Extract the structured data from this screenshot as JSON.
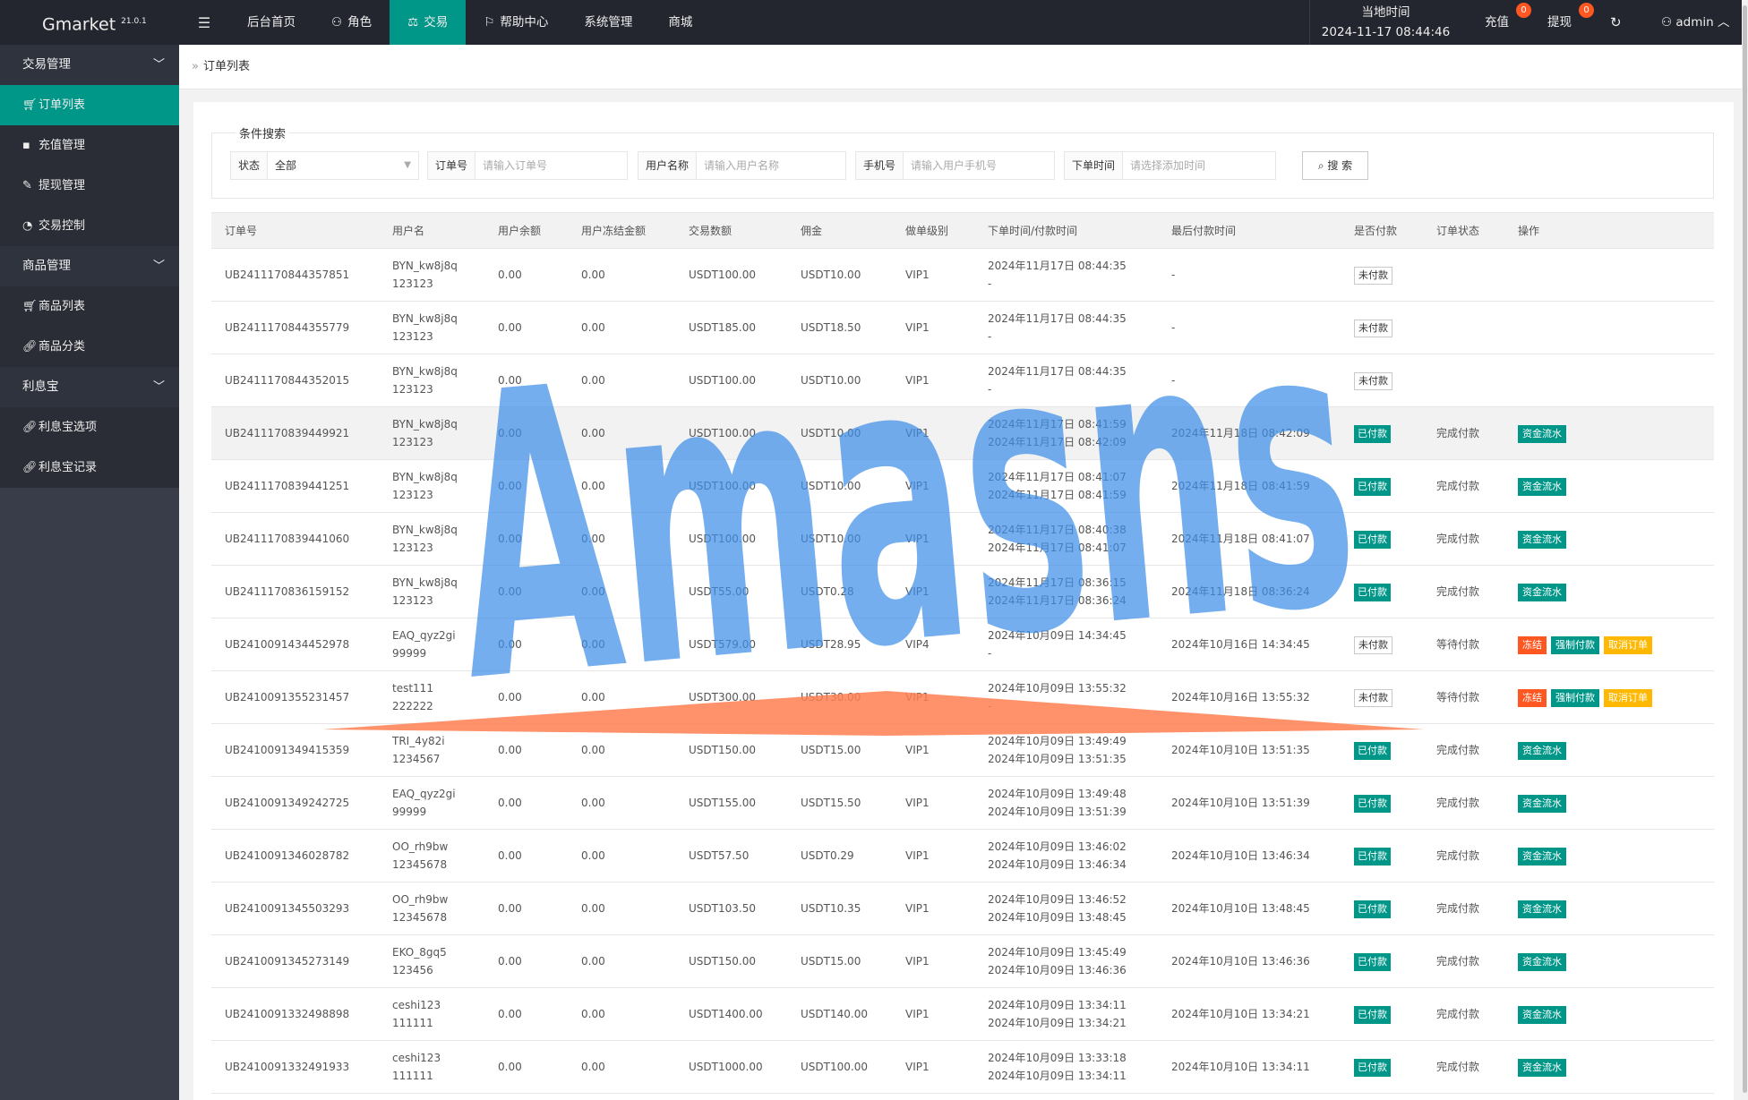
{
  "app": {
    "name": "Gmarket",
    "version": "21.0.1"
  },
  "nav": [
    {
      "label": "后台首页",
      "icon": ""
    },
    {
      "label": "角色",
      "icon": "user-icon"
    },
    {
      "label": "交易",
      "icon": "scale-icon",
      "active": true
    },
    {
      "label": "帮助中心",
      "icon": "flag-icon"
    },
    {
      "label": "系统管理",
      "icon": ""
    },
    {
      "label": "商城",
      "icon": ""
    }
  ],
  "header": {
    "clock_label": "当地时间",
    "clock_value": "2024-11-17 08:44:46",
    "recharge_label": "充值",
    "recharge_count": "0",
    "withdraw_label": "提现",
    "withdraw_count": "0",
    "user": "admin"
  },
  "sidebar": {
    "groups": [
      {
        "label": "交易管理",
        "items": [
          {
            "label": "订单列表",
            "icon": "cart-icon",
            "active": true
          },
          {
            "label": "充值管理",
            "icon": "chat-icon"
          },
          {
            "label": "提现管理",
            "icon": "wrench-icon"
          },
          {
            "label": "交易控制",
            "icon": "dashboard-icon"
          }
        ]
      },
      {
        "label": "商品管理",
        "items": [
          {
            "label": "商品列表",
            "icon": "cart-icon"
          },
          {
            "label": "商品分类",
            "icon": "link-icon"
          }
        ]
      },
      {
        "label": "利息宝",
        "items": [
          {
            "label": "利息宝选项",
            "icon": "link-icon"
          },
          {
            "label": "利息宝记录",
            "icon": "link-icon"
          }
        ]
      }
    ]
  },
  "breadcrumb": {
    "current": "订单列表"
  },
  "search": {
    "legend": "条件搜索",
    "status_label": "状态",
    "status_value": "全部",
    "order_label": "订单号",
    "order_placeholder": "请输入订单号",
    "user_label": "用户名称",
    "user_placeholder": "请输入用户名称",
    "phone_label": "手机号",
    "phone_placeholder": "请输入用户手机号",
    "time_label": "下单时间",
    "time_placeholder": "请选择添加时间",
    "button": "搜 索"
  },
  "table": {
    "columns": [
      "订单号",
      "用户名",
      "用户余额",
      "用户冻结金额",
      "交易数额",
      "佣金",
      "做单级别",
      "下单时间/付款时间",
      "最后付款时间",
      "是否付款",
      "订单状态",
      "操作"
    ],
    "rows": [
      {
        "id": "UB2411170844357851",
        "user": "BYN_kw8j8q",
        "phone": "123123",
        "balance": "0.00",
        "frozen": "0.00",
        "amount": "USDT100.00",
        "commission": "USDT10.00",
        "level": "VIP1",
        "order_time": "2024年11月17日 08:44:35",
        "pay_time": "-",
        "last_pay": "-",
        "paid": "未付款",
        "status": "",
        "actions": []
      },
      {
        "id": "UB2411170844355779",
        "user": "BYN_kw8j8q",
        "phone": "123123",
        "balance": "0.00",
        "frozen": "0.00",
        "amount": "USDT185.00",
        "commission": "USDT18.50",
        "level": "VIP1",
        "order_time": "2024年11月17日 08:44:35",
        "pay_time": "-",
        "last_pay": "-",
        "paid": "未付款",
        "status": "",
        "actions": []
      },
      {
        "id": "UB2411170844352015",
        "user": "BYN_kw8j8q",
        "phone": "123123",
        "balance": "0.00",
        "frozen": "0.00",
        "amount": "USDT100.00",
        "commission": "USDT10.00",
        "level": "VIP1",
        "order_time": "2024年11月17日 08:44:35",
        "pay_time": "-",
        "last_pay": "-",
        "paid": "未付款",
        "status": "",
        "actions": []
      },
      {
        "id": "UB2411170839449921",
        "user": "BYN_kw8j8q",
        "phone": "123123",
        "balance": "0.00",
        "frozen": "0.00",
        "amount": "USDT100.00",
        "commission": "USDT10.00",
        "level": "VIP1",
        "order_time": "2024年11月17日 08:41:59",
        "pay_time": "2024年11月17日 08:42:09",
        "last_pay": "2024年11月18日 08:42:09",
        "paid": "已付款",
        "status": "完成付款",
        "actions": [
          {
            "label": "资金流水",
            "color": "teal"
          }
        ],
        "highlight": true
      },
      {
        "id": "UB2411170839441251",
        "user": "BYN_kw8j8q",
        "phone": "123123",
        "balance": "0.00",
        "frozen": "0.00",
        "amount": "USDT100.00",
        "commission": "USDT10.00",
        "level": "VIP1",
        "order_time": "2024年11月17日 08:41:07",
        "pay_time": "2024年11月17日 08:41:59",
        "last_pay": "2024年11月18日 08:41:59",
        "paid": "已付款",
        "status": "完成付款",
        "actions": [
          {
            "label": "资金流水",
            "color": "teal"
          }
        ]
      },
      {
        "id": "UB2411170839441060",
        "user": "BYN_kw8j8q",
        "phone": "123123",
        "balance": "0.00",
        "frozen": "0.00",
        "amount": "USDT100.00",
        "commission": "USDT10.00",
        "level": "VIP1",
        "order_time": "2024年11月17日 08:40:38",
        "pay_time": "2024年11月17日 08:41:07",
        "last_pay": "2024年11月18日 08:41:07",
        "paid": "已付款",
        "status": "完成付款",
        "actions": [
          {
            "label": "资金流水",
            "color": "teal"
          }
        ]
      },
      {
        "id": "UB2411170836159152",
        "user": "BYN_kw8j8q",
        "phone": "123123",
        "balance": "0.00",
        "frozen": "0.00",
        "amount": "USDT55.00",
        "commission": "USDT0.28",
        "level": "VIP1",
        "order_time": "2024年11月17日 08:36:15",
        "pay_time": "2024年11月17日 08:36:24",
        "last_pay": "2024年11月18日 08:36:24",
        "paid": "已付款",
        "status": "完成付款",
        "actions": [
          {
            "label": "资金流水",
            "color": "teal"
          }
        ]
      },
      {
        "id": "UB2410091434452978",
        "user": "EAQ_qyz2gi",
        "phone": "99999",
        "balance": "0.00",
        "frozen": "0.00",
        "amount": "USDT579.00",
        "commission": "USDT28.95",
        "level": "VIP4",
        "order_time": "2024年10月09日 14:34:45",
        "pay_time": "-",
        "last_pay": "2024年10月16日 14:34:45",
        "paid": "未付款",
        "status": "等待付款",
        "actions": [
          {
            "label": "冻结",
            "color": "orange"
          },
          {
            "label": "强制付款",
            "color": "teal"
          },
          {
            "label": "取消订单",
            "color": "yellow"
          }
        ]
      },
      {
        "id": "UB2410091355231457",
        "user": "test111",
        "phone": "222222",
        "balance": "0.00",
        "frozen": "0.00",
        "amount": "USDT300.00",
        "commission": "USDT30.00",
        "level": "VIP1",
        "order_time": "2024年10月09日 13:55:32",
        "pay_time": "-",
        "last_pay": "2024年10月16日 13:55:32",
        "paid": "未付款",
        "status": "等待付款",
        "actions": [
          {
            "label": "冻结",
            "color": "orange"
          },
          {
            "label": "强制付款",
            "color": "teal"
          },
          {
            "label": "取消订单",
            "color": "yellow"
          }
        ]
      },
      {
        "id": "UB2410091349415359",
        "user": "TRI_4y82i",
        "phone": "1234567",
        "balance": "0.00",
        "frozen": "0.00",
        "amount": "USDT150.00",
        "commission": "USDT15.00",
        "level": "VIP1",
        "order_time": "2024年10月09日 13:49:49",
        "pay_time": "2024年10月09日 13:51:35",
        "last_pay": "2024年10月10日 13:51:35",
        "paid": "已付款",
        "status": "完成付款",
        "actions": [
          {
            "label": "资金流水",
            "color": "teal"
          }
        ]
      },
      {
        "id": "UB2410091349242725",
        "user": "EAQ_qyz2gi",
        "phone": "99999",
        "balance": "0.00",
        "frozen": "0.00",
        "amount": "USDT155.00",
        "commission": "USDT15.50",
        "level": "VIP1",
        "order_time": "2024年10月09日 13:49:48",
        "pay_time": "2024年10月09日 13:51:39",
        "last_pay": "2024年10月10日 13:51:39",
        "paid": "已付款",
        "status": "完成付款",
        "actions": [
          {
            "label": "资金流水",
            "color": "teal"
          }
        ]
      },
      {
        "id": "UB2410091346028782",
        "user": "OO_rh9bw",
        "phone": "12345678",
        "balance": "0.00",
        "frozen": "0.00",
        "amount": "USDT57.50",
        "commission": "USDT0.29",
        "level": "VIP1",
        "order_time": "2024年10月09日 13:46:02",
        "pay_time": "2024年10月09日 13:46:34",
        "last_pay": "2024年10月10日 13:46:34",
        "paid": "已付款",
        "status": "完成付款",
        "actions": [
          {
            "label": "资金流水",
            "color": "teal"
          }
        ]
      },
      {
        "id": "UB2410091345503293",
        "user": "OO_rh9bw",
        "phone": "12345678",
        "balance": "0.00",
        "frozen": "0.00",
        "amount": "USDT103.50",
        "commission": "USDT10.35",
        "level": "VIP1",
        "order_time": "2024年10月09日 13:46:52",
        "pay_time": "2024年10月09日 13:48:45",
        "last_pay": "2024年10月10日 13:48:45",
        "paid": "已付款",
        "status": "完成付款",
        "actions": [
          {
            "label": "资金流水",
            "color": "teal"
          }
        ]
      },
      {
        "id": "UB2410091345273149",
        "user": "EKO_8gq5",
        "phone": "123456",
        "balance": "0.00",
        "frozen": "0.00",
        "amount": "USDT150.00",
        "commission": "USDT15.00",
        "level": "VIP1",
        "order_time": "2024年10月09日 13:45:49",
        "pay_time": "2024年10月09日 13:46:36",
        "last_pay": "2024年10月10日 13:46:36",
        "paid": "已付款",
        "status": "完成付款",
        "actions": [
          {
            "label": "资金流水",
            "color": "teal"
          }
        ]
      },
      {
        "id": "UB2410091332498898",
        "user": "ceshi123",
        "phone": "111111",
        "balance": "0.00",
        "frozen": "0.00",
        "amount": "USDT1400.00",
        "commission": "USDT140.00",
        "level": "VIP1",
        "order_time": "2024年10月09日 13:34:11",
        "pay_time": "2024年10月09日 13:34:21",
        "last_pay": "2024年10月10日 13:34:21",
        "paid": "已付款",
        "status": "完成付款",
        "actions": [
          {
            "label": "资金流水",
            "color": "teal"
          }
        ]
      },
      {
        "id": "UB2410091332491933",
        "user": "ceshi123",
        "phone": "111111",
        "balance": "0.00",
        "frozen": "0.00",
        "amount": "USDT1000.00",
        "commission": "USDT100.00",
        "level": "VIP1",
        "order_time": "2024年10月09日 13:33:18",
        "pay_time": "2024年10月09日 13:34:11",
        "last_pay": "2024年10月10日 13:34:11",
        "paid": "已付款",
        "status": "完成付款",
        "actions": [
          {
            "label": "资金流水",
            "color": "teal"
          }
        ]
      }
    ]
  },
  "watermark": {
    "text": "Amasns",
    "color": "#3f8fe8"
  }
}
